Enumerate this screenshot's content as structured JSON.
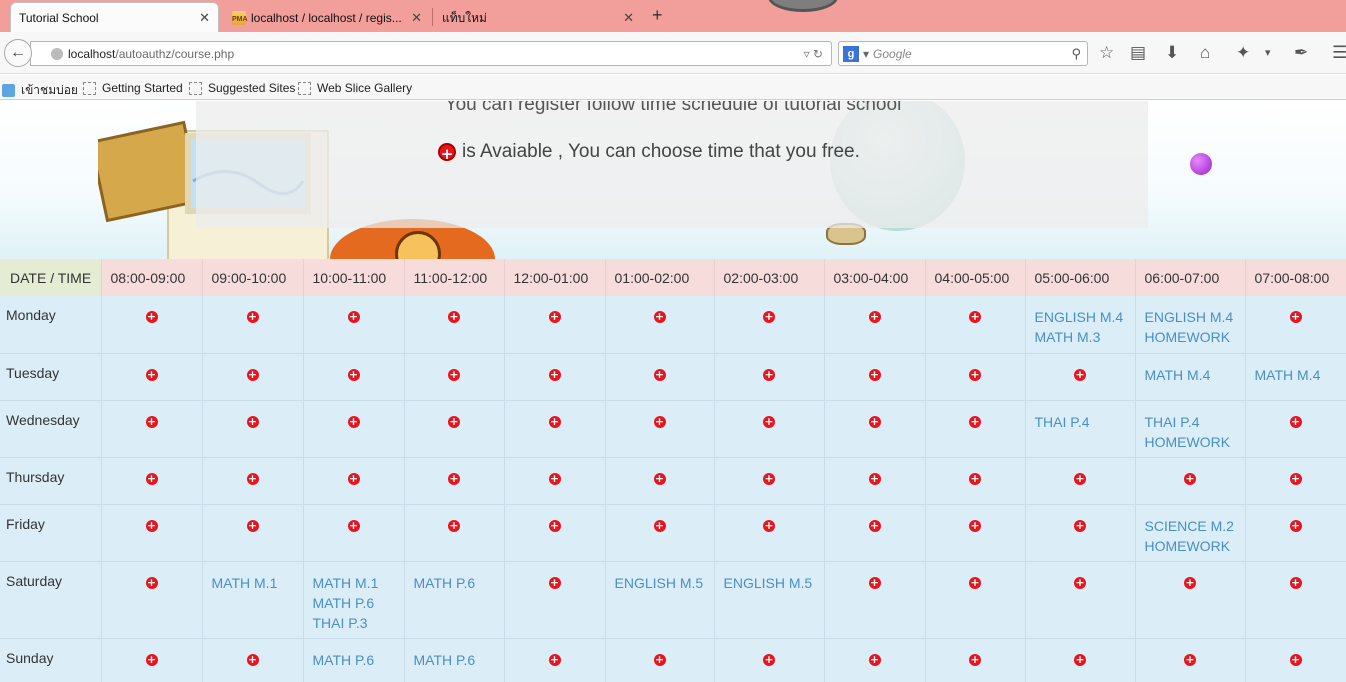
{
  "browser": {
    "tabs": [
      {
        "title": "Tutorial School",
        "active": true
      },
      {
        "title": "localhost / localhost / regis...",
        "favicon_text": "PMA"
      },
      {
        "title": "แท็บใหม่"
      }
    ],
    "new_tab": "+",
    "url_host": "localhost",
    "url_path": "/autoauthz/course.php",
    "search_placeholder": "Google",
    "bookmarks": [
      "เข้าชมบ่อย",
      "Getting Started",
      "Suggested Sites",
      "Web Slice Gallery"
    ],
    "icons": {
      "back": "back-arrow-icon",
      "search_engine": "google-g-icon",
      "star": "star-icon",
      "reading_list": "clipboard-icon",
      "download": "download-icon",
      "home": "home-icon",
      "addon": "addon-icon",
      "menu": "menu-icon"
    }
  },
  "page": {
    "intro_line": "You can register follow time schedule of tutorial school",
    "available_note": "is Avaiable , You can choose time that you free.",
    "available_symbol": "+",
    "colors": {
      "header_row": "#f7dcdc",
      "date_header": "#e4ecd3",
      "cell_bg": "#dbedf7",
      "subject_text": "#4a8fc4",
      "available_icon": "#e8151f"
    }
  },
  "schedule": {
    "date_time_label": "DATE / TIME",
    "times": [
      "08:00-09:00",
      "09:00-10:00",
      "10:00-11:00",
      "11:00-12:00",
      "12:00-01:00",
      "01:00-02:00",
      "02:00-03:00",
      "03:00-04:00",
      "04:00-05:00",
      "05:00-06:00",
      "06:00-07:00",
      "07:00-08:00"
    ],
    "rows": [
      {
        "day": "Monday",
        "cells": [
          [],
          [],
          [],
          [],
          [],
          [],
          [],
          [],
          [],
          [
            "ENGLISH M.4",
            "MATH M.3"
          ],
          [
            "ENGLISH M.4",
            "HOMEWORK"
          ],
          []
        ]
      },
      {
        "day": "Tuesday",
        "cells": [
          [],
          [],
          [],
          [],
          [],
          [],
          [],
          [],
          [],
          [],
          [
            "MATH M.4"
          ],
          [
            "MATH M.4"
          ]
        ]
      },
      {
        "day": "Wednesday",
        "cells": [
          [],
          [],
          [],
          [],
          [],
          [],
          [],
          [],
          [],
          [
            "THAI P.4"
          ],
          [
            "THAI P.4",
            "HOMEWORK"
          ],
          []
        ]
      },
      {
        "day": "Thursday",
        "cells": [
          [],
          [],
          [],
          [],
          [],
          [],
          [],
          [],
          [],
          [],
          [],
          []
        ]
      },
      {
        "day": "Friday",
        "cells": [
          [],
          [],
          [],
          [],
          [],
          [],
          [],
          [],
          [],
          [],
          [
            "SCIENCE M.2",
            "HOMEWORK"
          ],
          []
        ]
      },
      {
        "day": "Saturday",
        "cells": [
          [],
          [
            "MATH M.1"
          ],
          [
            "MATH M.1",
            "MATH P.6",
            "THAI P.3"
          ],
          [
            "MATH P.6"
          ],
          [],
          [
            "ENGLISH M.5"
          ],
          [
            "ENGLISH M.5"
          ],
          [],
          [],
          [],
          [],
          []
        ]
      },
      {
        "day": "Sunday",
        "cells": [
          [],
          [],
          [
            "MATH P.6"
          ],
          [
            "MATH P.6"
          ],
          [],
          [],
          [],
          [],
          [],
          [],
          [],
          []
        ]
      }
    ]
  }
}
